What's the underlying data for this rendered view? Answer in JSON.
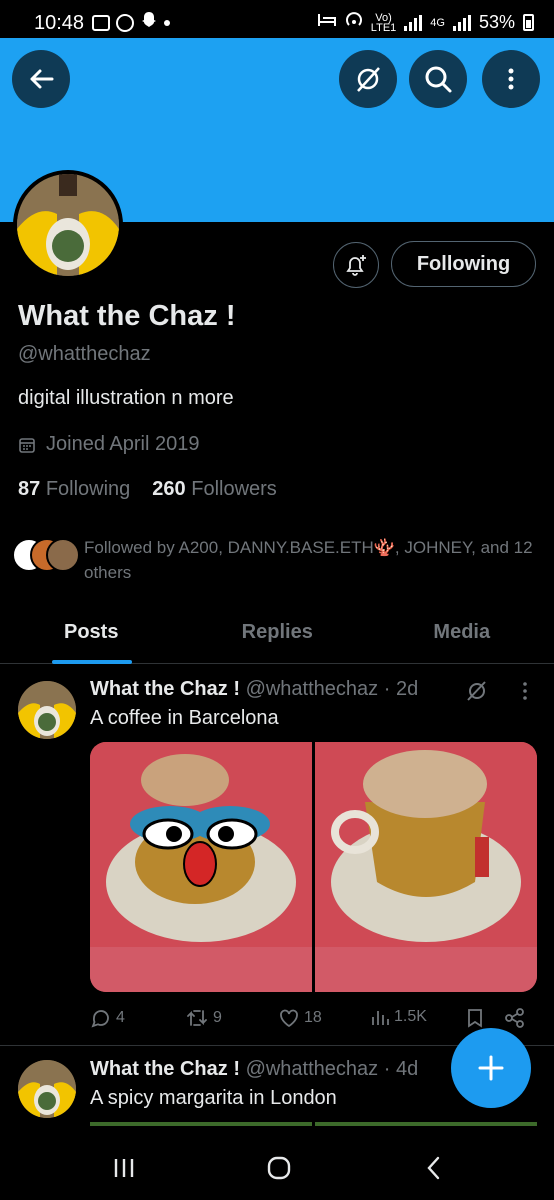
{
  "status_bar": {
    "time": "10:48",
    "lte_label": "LTE1",
    "vo_label": "Vo)",
    "net_label": "4G",
    "battery": "53%"
  },
  "profile": {
    "display_name": "What the Chaz !",
    "handle": "@whatthechaz",
    "bio": "digital illustration n more",
    "joined": "Joined April 2019",
    "following_count": "87",
    "following_label": "Following",
    "followers_count": "260",
    "followers_label": "Followers",
    "follow_button": "Following",
    "followed_by": "Followed by A200, DANNY.BASE.ETH🪸, JOHNEY, and 12 others"
  },
  "tabs": [
    {
      "label": "Posts",
      "active": true
    },
    {
      "label": "Replies",
      "active": false
    },
    {
      "label": "Media",
      "active": false
    }
  ],
  "posts": [
    {
      "name": "What the Chaz !",
      "handle": "@whatthechaz",
      "time": "· 2d",
      "text": "A coffee in Barcelona",
      "replies": "4",
      "reposts": "9",
      "likes": "18",
      "views": "1.5K"
    },
    {
      "name": "What the Chaz !",
      "handle": "@whatthechaz",
      "time": "· 4d",
      "text": "A spicy margarita in London"
    }
  ],
  "colors": {
    "banner": "#1da1f2",
    "accent": "#1d9bf0",
    "muted": "#71767b"
  }
}
